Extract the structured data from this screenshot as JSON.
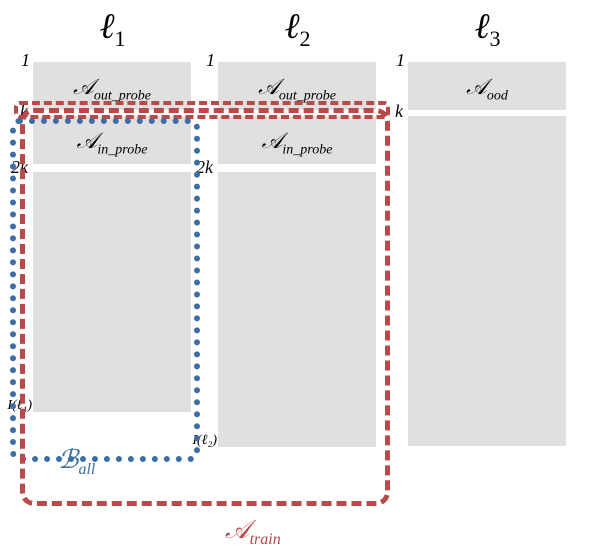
{
  "columns": {
    "l1": {
      "header": "ℓ₁",
      "out_probe": "𝒜_out_probe",
      "in_probe": "𝒜_in_probe",
      "tick1": "1",
      "tick_k": "k",
      "tick_2k": "2k",
      "tick_I": "I(ℓ₁)"
    },
    "l2": {
      "header": "ℓ₂",
      "out_probe": "𝒜_out_probe",
      "in_probe": "𝒜_in_probe",
      "tick1": "1",
      "tick_2k": "2k",
      "tick_I": "I(ℓ₂)"
    },
    "l3": {
      "header": "ℓ₃",
      "ood": "𝒜_ood",
      "tick1": "1",
      "tick_k": "k"
    }
  },
  "sets": {
    "B_all": "ℬ_all",
    "A_train": "𝒜_train"
  },
  "chart_data": {
    "type": "diagram",
    "description": "Three language columns ℓ₁, ℓ₂, ℓ₃, each containing index ranges. Rows 1..k are out_probe for ℓ₁,ℓ₂ and ood for ℓ₃. Rows k..2k are in_probe for ℓ₁,ℓ₂. Rows 2k..I(ℓ) are the remaining data. ℬ_all (blue dotted) covers ℓ₁ rows k..I(ℓ₁). 𝒜_train (red dashed) covers ℓ₁ rows k..I(ℓ₁) plus ℓ₂ rows k..I(ℓ₂) (a second red dashed box also highlights row segment near k on ℓ₃).",
    "columns": [
      {
        "name": "ℓ₁",
        "segments": [
          {
            "range": "1..k",
            "label": "𝒜_out_probe"
          },
          {
            "range": "k..2k",
            "label": "𝒜_in_probe"
          },
          {
            "range": "2k..I(ℓ₁)",
            "label": ""
          }
        ]
      },
      {
        "name": "ℓ₂",
        "segments": [
          {
            "range": "1..k",
            "label": "𝒜_out_probe"
          },
          {
            "range": "k..2k",
            "label": "𝒜_in_probe"
          },
          {
            "range": "2k..I(ℓ₂)",
            "label": ""
          }
        ]
      },
      {
        "name": "ℓ₃",
        "segments": [
          {
            "range": "1..k",
            "label": "𝒜_ood"
          },
          {
            "range": "k..end",
            "label": ""
          }
        ]
      }
    ],
    "region_boxes": [
      {
        "name": "ℬ_all",
        "color": "blue-dotted",
        "covers": "ℓ₁ rows k..I(ℓ₁)"
      },
      {
        "name": "𝒜_train",
        "color": "red-dashed",
        "covers": "ℓ₁ and ℓ₂ rows k..I(ℓ₁/ℓ₂), plus small strip around row k across ℓ₁-ℓ₃"
      }
    ]
  }
}
